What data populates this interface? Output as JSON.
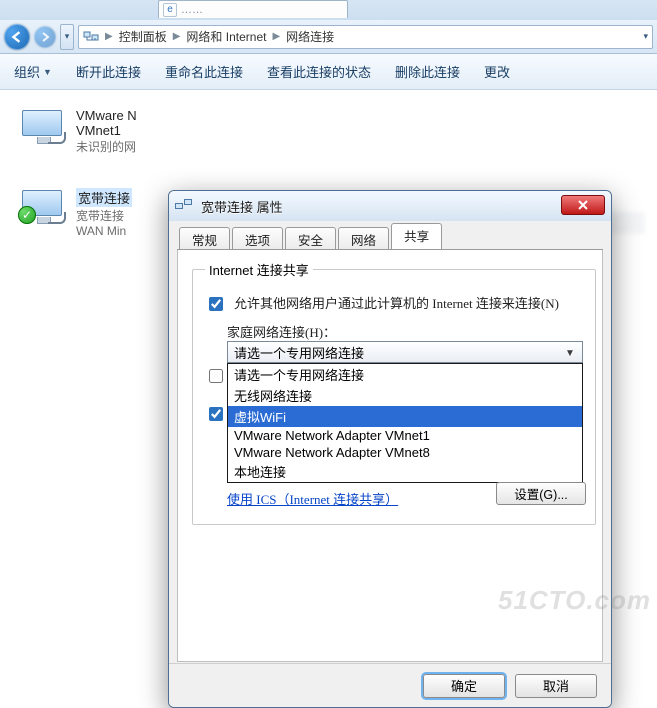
{
  "titlebar": {
    "blurred_tab_text": "……"
  },
  "breadcrumb": {
    "items": [
      "控制面板",
      "网络和 Internet",
      "网络连接"
    ]
  },
  "commandbar": {
    "organize": "组织",
    "disconnect": "断开此连接",
    "rename": "重命名此连接",
    "view_status": "查看此连接的状态",
    "delete": "删除此连接",
    "change": "更改"
  },
  "connections": [
    {
      "name": "VMware N",
      "line2": "VMnet1",
      "line3": "未识别的网",
      "selected": false,
      "checkmark": false
    },
    {
      "name": "宽带连接",
      "line2": "宽带连接",
      "line3": "WAN Min",
      "selected": true,
      "checkmark": true
    }
  ],
  "dialog": {
    "title": "宽带连接 属性",
    "tabs": [
      "常规",
      "选项",
      "安全",
      "网络",
      "共享"
    ],
    "active_tab_index": 4,
    "group_legend": "Internet 连接共享",
    "allow_label": "允许其他网络用户通过此计算机的 Internet 连接来连接(N)",
    "allow_checked": true,
    "home_net_label": "家庭网络连接(H)：",
    "combo_value": "请选一个专用网络连接",
    "dropdown_options": [
      "请选一个专用网络连接",
      "无线网络连接",
      "虚拟WiFi",
      "VMware Network Adapter VMnet1",
      "VMware Network Adapter VMnet8",
      "本地连接"
    ],
    "dropdown_selected_index": 2,
    "second_checkbox_checked_upper": false,
    "second_checkbox_checked_lower": true,
    "ics_link": "使用 ICS（Internet 连接共享）",
    "settings_button": "设置(G)...",
    "ok": "确定",
    "cancel": "取消"
  },
  "watermark": "51CTO.com"
}
